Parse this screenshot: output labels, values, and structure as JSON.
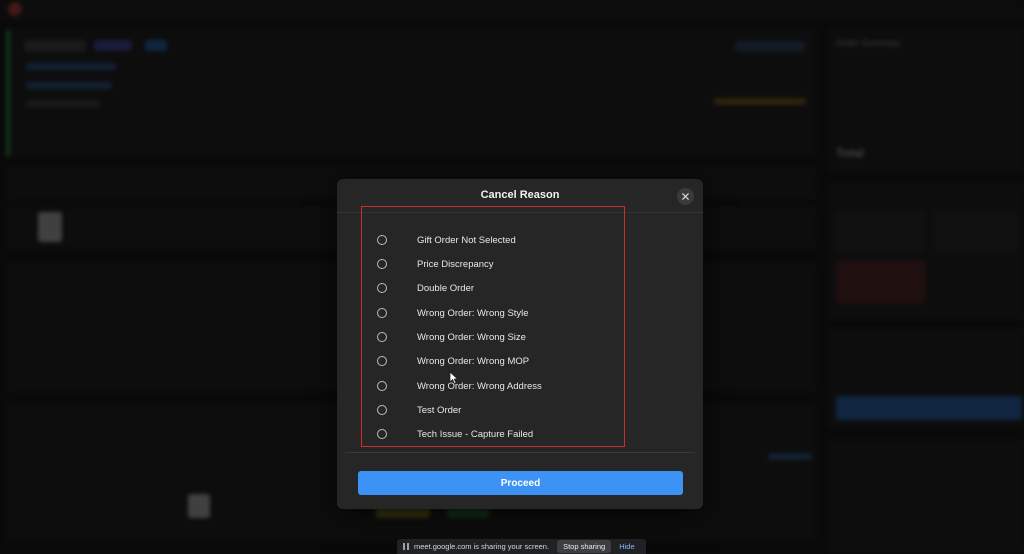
{
  "modal": {
    "title": "Cancel Reason",
    "options": [
      "Gift Order Not Selected",
      "Price Discrepancy",
      "Double Order",
      "Wrong Order: Wrong Style",
      "Wrong Order: Wrong Size",
      "Wrong Order: Wrong MOP",
      "Wrong Order: Wrong Address",
      "Test Order",
      "Tech Issue - Capture Failed"
    ],
    "proceed_label": "Proceed",
    "accent": "#3d92f5",
    "highlight_color": "#d12a2a"
  },
  "share_bar": {
    "message": "meet.google.com is sharing your screen.",
    "stop_label": "Stop sharing",
    "hide_label": "Hide"
  },
  "background": {
    "status_accent": "#2fa84f",
    "sidebar": {
      "order_summary_title": "Order Summary",
      "total_label": "Total"
    }
  }
}
